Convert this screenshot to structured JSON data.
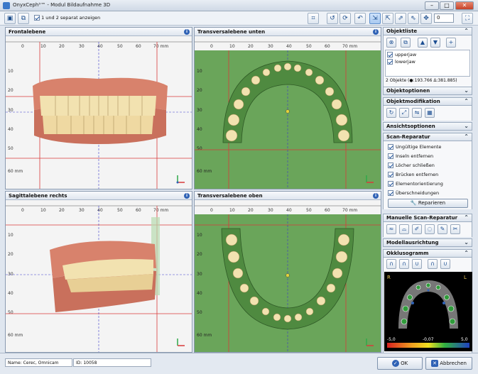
{
  "window": {
    "title": "OnyxCeph³™ - Modul Bildaufnahme 3D"
  },
  "toolbar": {
    "separate_label": "1 und 2 separat anzeigen",
    "spin_value": "0"
  },
  "panels": {
    "front": {
      "title": "Frontalebene",
      "unit": "70 mm",
      "vunit": "60 mm",
      "hticks": [
        "0",
        "10",
        "20",
        "30",
        "40",
        "50",
        "60"
      ],
      "vticks": [
        "10",
        "20",
        "30",
        "40",
        "50"
      ]
    },
    "trans_bottom": {
      "title": "Transversalebene unten",
      "unit": "70 mm",
      "vunit": "60 mm",
      "hticks": [
        "0",
        "10",
        "20",
        "30",
        "40",
        "50",
        "60"
      ],
      "vticks": [
        "10",
        "20",
        "30",
        "40",
        "50"
      ]
    },
    "sagittal": {
      "title": "Sagittalebene rechts",
      "unit": "70 mm",
      "vunit": "60 mm",
      "hticks": [
        "0",
        "10",
        "20",
        "30",
        "40",
        "50",
        "60"
      ],
      "vticks": [
        "10",
        "20",
        "30",
        "40",
        "50"
      ]
    },
    "trans_top": {
      "title": "Transversalebene oben",
      "unit": "70 mm",
      "vunit": "60 mm",
      "hticks": [
        "0",
        "10",
        "20",
        "30",
        "40",
        "50",
        "60"
      ],
      "vticks": [
        "10",
        "20",
        "30",
        "40",
        "50"
      ]
    }
  },
  "sidebar": {
    "objektliste": "Objektliste",
    "objects": [
      "upperjaw",
      "lowerjaw"
    ],
    "objects_summary": "2 Objekte (●:193.766 Δ:381.885)",
    "objektoptionen": "Objektoptionen",
    "objektmodifikation": "Objektmodifikation",
    "ansichtsoptionen": "Ansichtsoptionen",
    "scanreparatur": "Scan-Reparatur",
    "repair_items": [
      "Ungültige Elemente",
      "Inseln entfernen",
      "Löcher schließen",
      "Brücken entfernen",
      "Elementorientierung",
      "Überschneidungen"
    ],
    "repair_button": "Reparieren",
    "manuelle": "Manuelle Scan-Reparatur",
    "modellausrichtung": "Modellausrichtung",
    "okklusogramm": "Okklusogramm",
    "occ_r": "R",
    "occ_l": "L",
    "scale": [
      "-5,0",
      "-0,07",
      "5,0"
    ]
  },
  "status": {
    "name": "Name: Cerec, Omnicam",
    "id": "ID: 10058",
    "ok": "OK",
    "cancel": "Abbrechen"
  },
  "colors": {
    "accent": "#2f62b5",
    "grid_red": "#d83a3a",
    "trans_bg": "#6aa55a",
    "gum": "#d8826c",
    "tooth": "#f2e2b0"
  }
}
